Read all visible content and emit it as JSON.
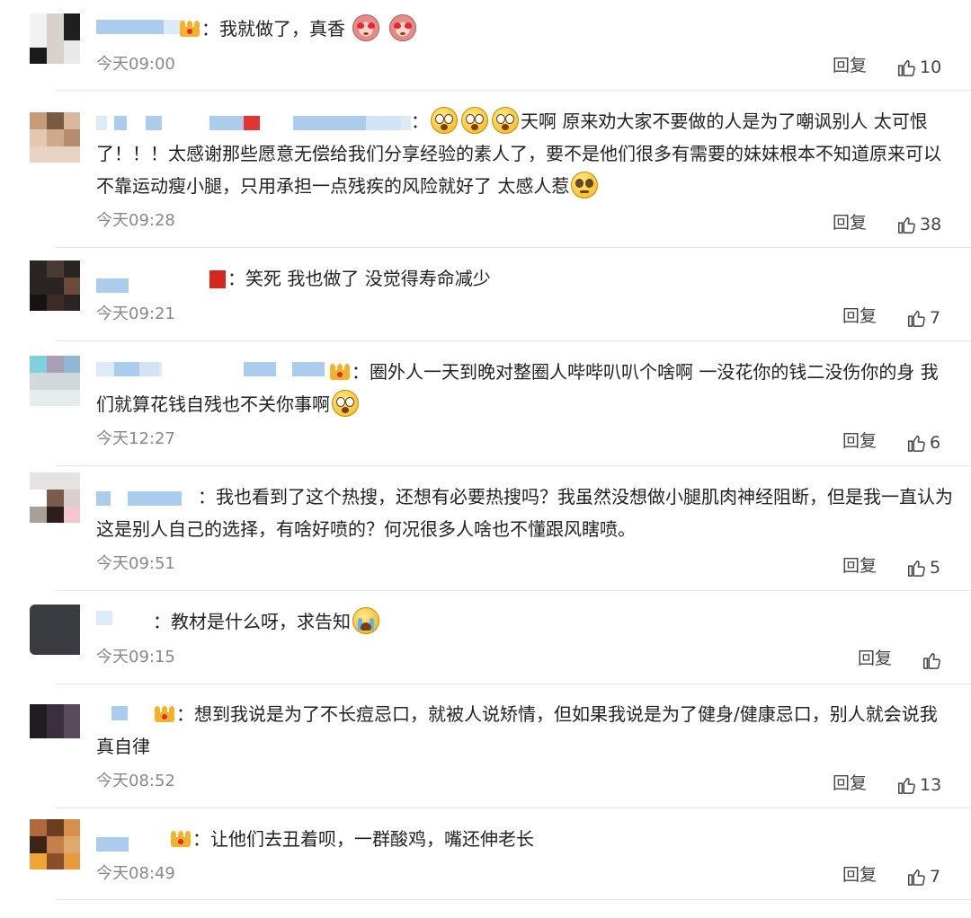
{
  "ui": {
    "reply_label": "回复",
    "colors": {
      "text": "#222222",
      "time": "#888888",
      "divider": "#e6e6e6",
      "name_blocks": "#9cc3ea"
    }
  },
  "comments": [
    {
      "name_redacted": true,
      "body_parts": [
        "我就做了，真香"
      ],
      "time": "今天09:00",
      "likes": "10"
    },
    {
      "name_redacted": true,
      "body_parts": [
        "天啊 原来劝大家不要做的人是为了嘲讽别人 太可恨了！！！太感谢那些愿意无偿给我们分享经验的素人了，要不是他们很多有需要的妹妹根本不知道原来可以不靠运动瘦小腿，只用承担一点残疾的风险就好了 太感人惹"
      ],
      "time": "今天09:28",
      "likes": "38"
    },
    {
      "name_redacted": true,
      "body_parts": [
        "笑死 我也做了 没觉得寿命减少"
      ],
      "time": "今天09:21",
      "likes": "7"
    },
    {
      "name_redacted": true,
      "body_parts": [
        "圈外人一天到晚对整圈人哔哔叭叭个啥啊 一没花你的钱二没伤你的身 我们就算花钱自残也不关你事啊"
      ],
      "time": "今天12:27",
      "likes": "6"
    },
    {
      "name_redacted": true,
      "body_parts": [
        "我也看到了这个热搜，还想有必要热搜吗？我虽然没想做小腿肌肉神经阻断，但是我一直认为这是别人自己的选择，有啥好喷的？何况很多人啥也不懂跟风瞎喷。"
      ],
      "time": "今天09:51",
      "likes": "5"
    },
    {
      "name_redacted": true,
      "body_parts": [
        "教材是什么呀，求告知"
      ],
      "time": "今天09:15",
      "likes": ""
    },
    {
      "name_redacted": true,
      "body_parts": [
        "想到我说是为了不长痘忌口，就被人说矫情，但如果我说是为了健身/健康忌口，别人就会说我真自律"
      ],
      "time": "今天08:52",
      "likes": "13"
    },
    {
      "name_redacted": true,
      "body_parts": [
        "让他们去丑着呗，一群酸鸡，嘴还伸老长"
      ],
      "time": "今天08:49",
      "likes": "7"
    }
  ]
}
